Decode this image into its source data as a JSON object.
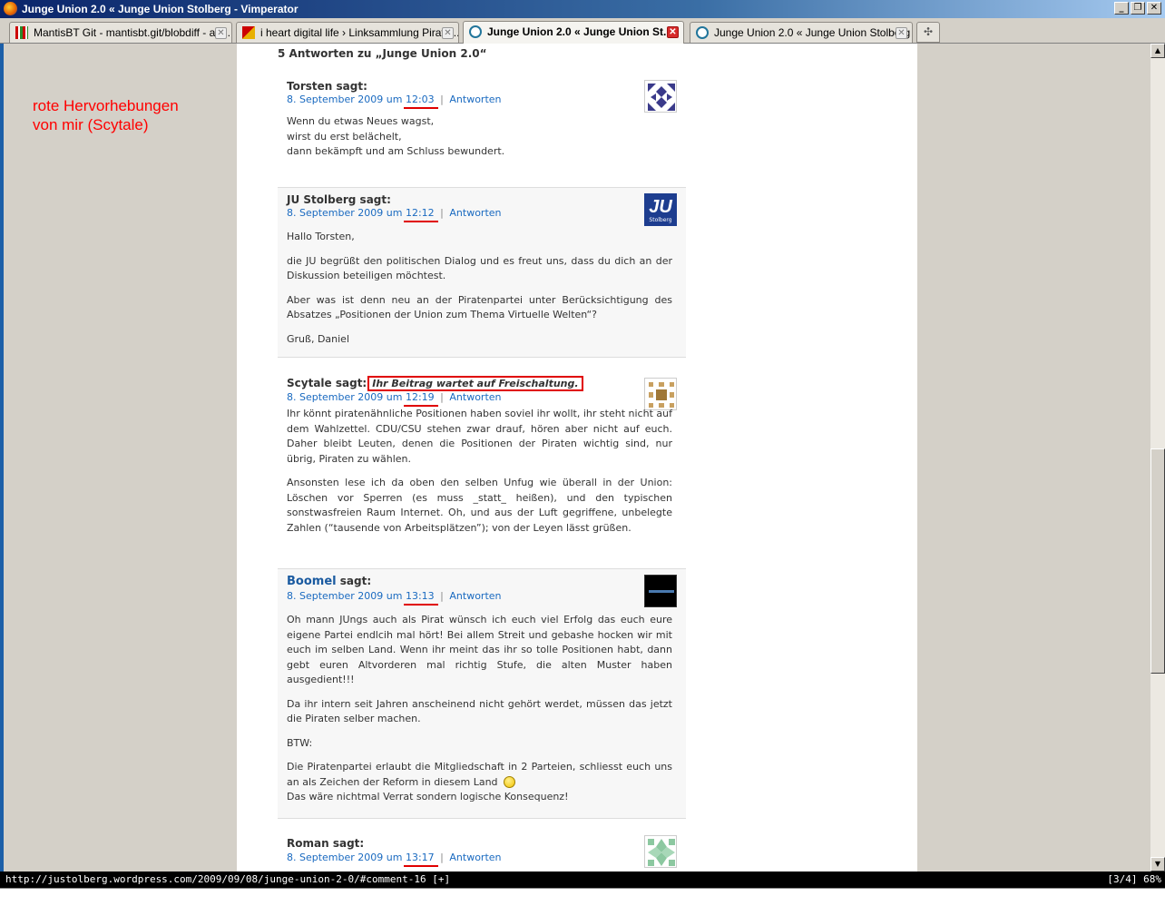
{
  "window": {
    "title": "Junge Union 2.0 « Junge Union Stolberg - Vimperator",
    "buttons": [
      "_",
      "❐",
      "✕"
    ]
  },
  "tabs": [
    {
      "label": "MantisBT Git - mantisbt.git/blobdiff - ap...",
      "active": false
    },
    {
      "label": "i heart digital life › Linksammlung Pirate...",
      "active": false
    },
    {
      "label": "Junge Union 2.0 « Junge Union St...",
      "active": true
    },
    {
      "label": "Junge Union 2.0 « Junge Union Stolberg",
      "active": false
    }
  ],
  "new_tab_symbol": "✣",
  "annotation": {
    "line1": "rote Hervorhebungen",
    "line2": "von mir (Scytale)"
  },
  "page": {
    "comments_title": "5 Antworten zu „Junge Union 2.0“",
    "says": "sagt:",
    "reply": "Antworten",
    "separator": "|"
  },
  "comments": [
    {
      "author": "Torsten",
      "date": "8. September 2009 um",
      "time": "12:03",
      "paragraphs": [
        "Wenn du etwas Neues wagst,\nwirst du erst belächelt,\ndann bekämpft und am Schluss bewundert."
      ]
    },
    {
      "author": "JU Stolberg",
      "date": "8. September 2009 um",
      "time": "12:12",
      "avatar_text": "JU",
      "avatar_sub": "Stolberg",
      "paragraphs": [
        "Hallo Torsten,",
        "die JU begrüßt den politischen Dialog und es freut uns, dass du dich an der Diskussion beteiligen möchtest.",
        "Aber was ist denn neu an der Piratenpartei unter Berücksichtigung des Absatzes „Positionen der Union zum Thema Virtuelle Welten“?",
        "Gruß, Daniel"
      ]
    },
    {
      "author": "Scytale",
      "date": "8. September 2009 um",
      "time": "12:19",
      "moderation": "Ihr Beitrag wartet auf Freischaltung.",
      "paragraphs": [
        "Ihr könnt piratenähnliche Positionen haben soviel ihr wollt, ihr steht nicht auf dem Wahlzettel. CDU/CSU stehen zwar drauf, hören aber nicht auf euch. Daher bleibt Leuten, denen die Positionen der Piraten wichtig sind, nur übrig, Piraten zu wählen.",
        "Ansonsten lese ich da oben den selben Unfug wie überall in der Union: Löschen vor Sperren (es muss _statt_ heißen), und den typischen sonstwasfreien Raum Internet. Oh, und aus der Luft gegriffene, unbelegte Zahlen (“tausende von Arbeitsplätzen”); von der Leyen lässt grüßen."
      ]
    },
    {
      "author": "Boomel",
      "date": "8. September 2009 um",
      "time": "13:13",
      "paragraphs": [
        "Oh mann JUngs auch als Pirat wünsch ich euch viel Erfolg das euch eure eigene Partei endlcih mal hört! Bei allem Streit und gebashe hocken wir mit euch im selben Land. Wenn ihr meint das ihr so tolle Positionen habt, dann gebt euren Altvorderen mal richtig Stufe, die alten Muster haben ausgedient!!!",
        "Da ihr intern seit Jahren anscheinend nicht gehört werdet, müssen das jetzt die Piraten selber machen.",
        "BTW:",
        "Die Piratenpartei erlaubt die Mitgliedschaft in 2 Parteien, schliesst euch uns an als Zeichen der Reform in diesem Land",
        "Das wäre nichtmal Verrat sondern logische Konsequenz!"
      ]
    },
    {
      "author": "Roman",
      "date": "8. September 2009 um",
      "time": "13:17",
      "paragraphs": []
    }
  ],
  "statusbar": {
    "url": "http://justolberg.wordpress.com/2009/09/08/junge-union-2-0/#comment-16 [+]",
    "position": "[3/4]  68%"
  },
  "colors": {
    "highlight": "#e00000",
    "link": "#1a6ac0",
    "titlebar": "#0a246a"
  },
  "icons": [
    "firefox-icon",
    "mantis-favicon",
    "heart-favicon",
    "wordpress-favicon",
    "smiley-icon"
  ]
}
